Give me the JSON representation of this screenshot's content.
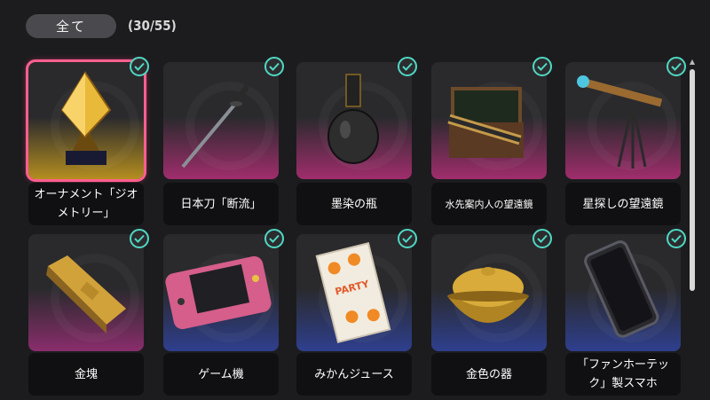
{
  "filter": {
    "label": "全て"
  },
  "count": "(30/55)",
  "colors": {
    "check": "#4fd8c4",
    "selected_border": "#ff5f8f",
    "gold": "#c9a227",
    "pink": "#c0347c",
    "blue": "#3a4ea8"
  },
  "items": [
    {
      "label": "オーナメント「ジオメトリー」",
      "line1": "オーナメント「ジオ",
      "line2": "メトリー」",
      "tier": "gold",
      "icon": "crystal-ornament-icon",
      "owned": true,
      "selected": true
    },
    {
      "label": "日本刀「断流」",
      "tier": "pink",
      "icon": "katana-icon",
      "owned": true
    },
    {
      "label": "墨染の瓶",
      "tier": "pink",
      "icon": "black-vase-icon",
      "owned": true
    },
    {
      "label": "水先案内人の望遠鏡",
      "tier": "pink",
      "icon": "spyglass-box-icon",
      "owned": true
    },
    {
      "label": "星探しの望遠鏡",
      "tier": "pink",
      "icon": "tripod-telescope-icon",
      "owned": true
    },
    {
      "label": "金塊",
      "tier": "pink",
      "icon": "gold-bar-icon",
      "owned": true
    },
    {
      "label": "ゲーム機",
      "tier": "blue",
      "icon": "handheld-console-icon",
      "owned": true
    },
    {
      "label": "みかんジュース",
      "tier": "blue",
      "icon": "orange-juice-box-icon",
      "owned": true,
      "box_text": "PARTY"
    },
    {
      "label": "金色の器",
      "tier": "blue",
      "icon": "golden-bowl-icon",
      "owned": true
    },
    {
      "label": "「ファンホーテック」製スマホ",
      "line1": "「ファンホーテッ",
      "line2": "ク」製スマホ",
      "tier": "blue",
      "icon": "smartphone-icon",
      "owned": true
    }
  ]
}
